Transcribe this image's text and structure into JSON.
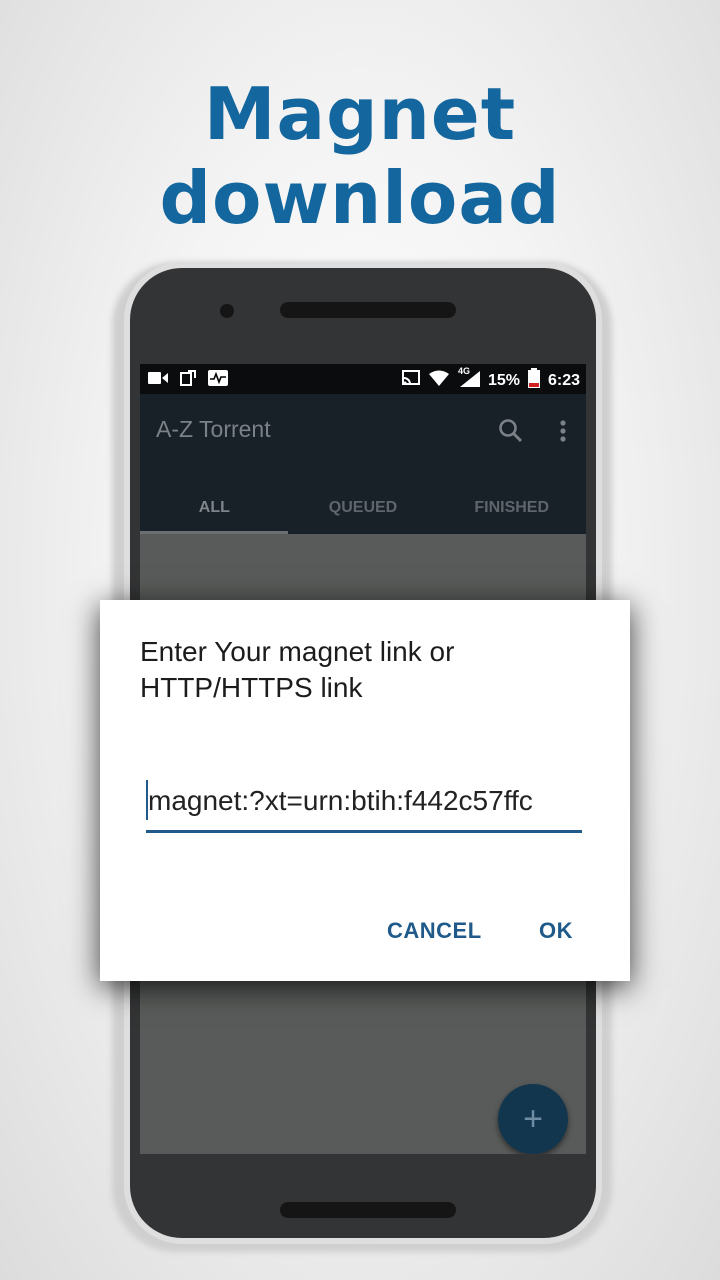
{
  "headline": "Magnet download",
  "status_bar": {
    "battery": "15%",
    "time": "6:23",
    "network": "4G"
  },
  "app": {
    "title": "A-Z Torrent",
    "tabs": [
      {
        "label": "ALL",
        "active": true
      },
      {
        "label": "QUEUED",
        "active": false
      },
      {
        "label": "FINISHED",
        "active": false
      }
    ],
    "fab_label": "+"
  },
  "dialog": {
    "title_line1": "Enter Your magnet link or",
    "title_line2": "HTTP/HTTPS link",
    "input_value": "magnet:?xt=urn:btih:f442c57ffc",
    "cancel_label": "CANCEL",
    "ok_label": "OK"
  },
  "colors": {
    "headline": "#13669e",
    "accent": "#1f5a8a",
    "appbar": "#182028",
    "fab": "#13364f"
  }
}
